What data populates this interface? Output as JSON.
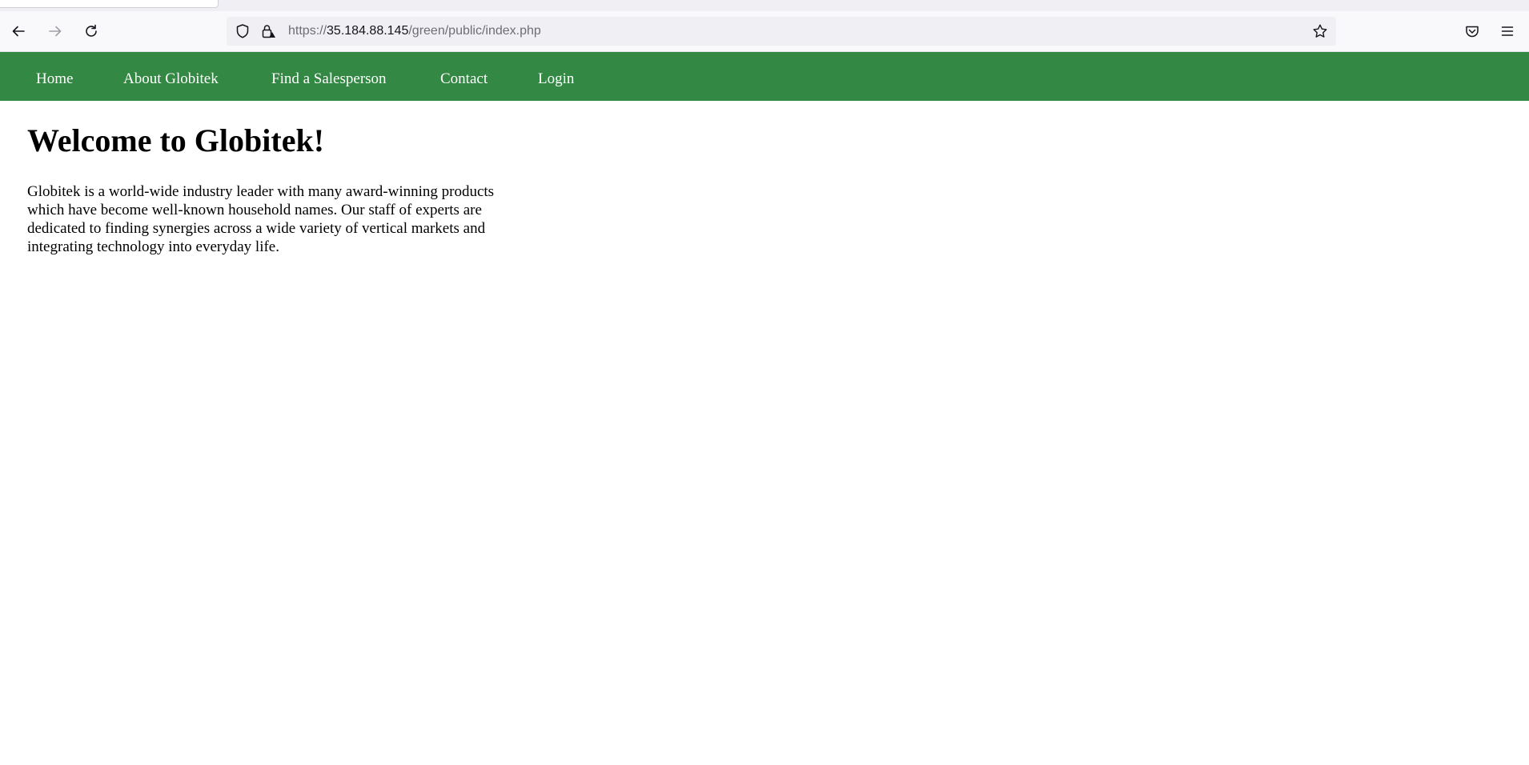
{
  "browser": {
    "url": {
      "scheme": "https://",
      "host": "35.184.88.145",
      "path": "/green/public/index.php"
    },
    "icons": {
      "back": "back-arrow-icon",
      "forward": "forward-arrow-icon",
      "reload": "reload-icon",
      "tracking": "shield-icon",
      "security": "lock-warning-icon",
      "bookmark": "star-icon",
      "pocket": "pocket-icon",
      "menu": "hamburger-menu-icon"
    }
  },
  "site": {
    "accent_color": "#338844",
    "nav": [
      {
        "label": "Home"
      },
      {
        "label": "About Globitek"
      },
      {
        "label": "Find a Salesperson"
      },
      {
        "label": "Contact"
      },
      {
        "label": "Login"
      }
    ]
  },
  "main": {
    "title": "Welcome to Globitek!",
    "intro": "Globitek is a world-wide industry leader with many award-winning products which have become well-known household names. Our staff of experts are dedicated to finding synergies across a wide variety of vertical markets and integrating technology into everyday life."
  }
}
